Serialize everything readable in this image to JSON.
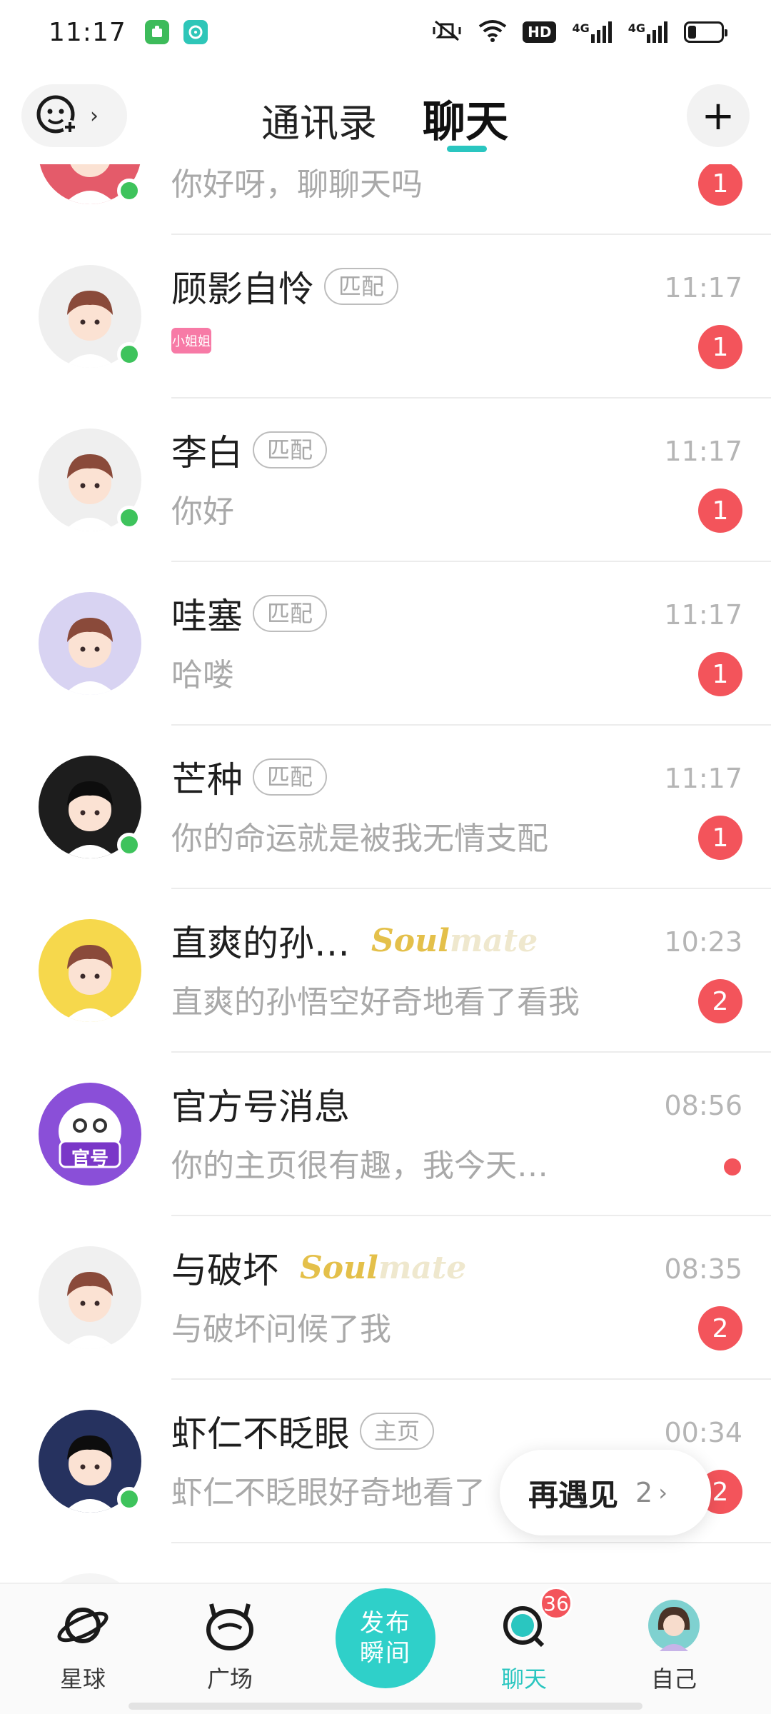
{
  "status_bar": {
    "time": "11:17",
    "hd": "HD",
    "net1": "4G",
    "net2": "4G"
  },
  "header": {
    "tab_contacts": "通讯录",
    "tab_chat": "聊天",
    "mood_chevron": "›",
    "plus": "+"
  },
  "chats": [
    {
      "name": "",
      "tag": "",
      "preview": "你好呀，聊聊天吗",
      "time": "",
      "unread": "1",
      "online": true,
      "avatar_color": "#e45b6a"
    },
    {
      "name": "顾影自怜",
      "tag": "匹配",
      "preview": "",
      "sticker": "小姐姐",
      "time": "11:17",
      "unread": "1",
      "online": true,
      "avatar_color": "#efefef"
    },
    {
      "name": "李白",
      "tag": "匹配",
      "preview": "你好",
      "time": "11:17",
      "unread": "1",
      "online": true,
      "avatar_color": "#efefef"
    },
    {
      "name": "哇塞",
      "tag": "匹配",
      "preview": "哈喽",
      "time": "11:17",
      "unread": "1",
      "online": false,
      "avatar_color": "#d8d3f2"
    },
    {
      "name": "芒种",
      "tag": "匹配",
      "preview": "你的命运就是被我无情支配",
      "time": "11:17",
      "unread": "1",
      "online": true,
      "avatar_color": "#1d1d1d"
    },
    {
      "name": "直爽的孙…",
      "soulmate": true,
      "preview": "直爽的孙悟空好奇地看了看我",
      "time": "10:23",
      "unread": "2",
      "online": false,
      "avatar_color": "#f6d84c"
    },
    {
      "name": "官方号消息",
      "preview": "你的主页很有趣，我今天…",
      "time": "08:56",
      "dot": true,
      "online": false,
      "avatar_color": "#8a4fd8",
      "avatar_text": "官号"
    },
    {
      "name": "与破坏",
      "soulmate": true,
      "preview": "与破坏问候了我",
      "time": "08:35",
      "unread": "2",
      "online": false,
      "avatar_color": "#f0f0f0"
    },
    {
      "name": "虾仁不眨眼",
      "tag": "主页",
      "preview": "虾仁不眨眼好奇地看了",
      "time": "00:34",
      "unread": "2",
      "online": true,
      "avatar_color": "#26325f"
    },
    {
      "name": "",
      "tag": "",
      "preview": "",
      "time": "",
      "online": false,
      "avatar_color": "#f5f5f5"
    }
  ],
  "soulmate_text": {
    "part1": "Soul",
    "part2": "mate"
  },
  "meet_again": {
    "label": "再遇见",
    "count": "2",
    "chevron": "›"
  },
  "bottom_nav": {
    "planet": "星球",
    "square": "广场",
    "publish_line1": "发布",
    "publish_line2": "瞬间",
    "chat": "聊天",
    "chat_badge": "36",
    "me": "自己"
  },
  "colors": {
    "accent": "#2ac6c0",
    "badge": "#f3545b",
    "online": "#3ec35c"
  }
}
